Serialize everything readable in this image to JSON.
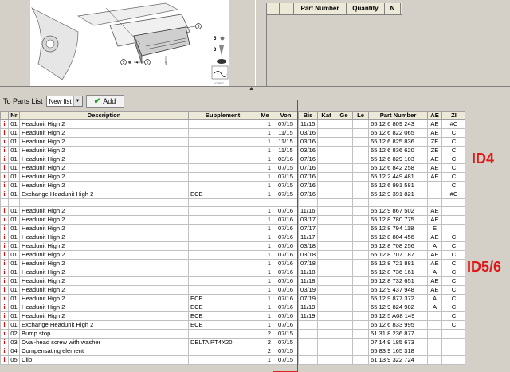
{
  "diagram": {
    "callouts": [
      "1",
      "2",
      "3",
      "4",
      "5"
    ],
    "legend_numbers": [
      "5",
      "3"
    ],
    "ref_code": "473902"
  },
  "parts_panel": {
    "headers": [
      "Part Number",
      "Quantity",
      "N"
    ]
  },
  "toolbar": {
    "to_parts_list_label": "To Parts List",
    "list_value": "New list",
    "add_label": "Add"
  },
  "table": {
    "headers": [
      "",
      "Nr",
      "Description",
      "Supplement",
      "Me",
      "Von",
      "Bis",
      "Kat",
      "Ge",
      "Le",
      "Part Number",
      "AE",
      "ZI"
    ],
    "rows": [
      {
        "nr": "01",
        "desc": "Headunit High 2",
        "sup": "",
        "me": "1",
        "von": "07/15",
        "bis": "11/15",
        "part": "65 12 6 809 243",
        "ae": "AE",
        "zi": "#C"
      },
      {
        "nr": "01",
        "desc": "Headunit High 2",
        "sup": "",
        "me": "1",
        "von": "11/15",
        "bis": "03/16",
        "part": "65 12 6 822 065",
        "ae": "AE",
        "zi": "C"
      },
      {
        "nr": "01",
        "desc": "Headunit High 2",
        "sup": "",
        "me": "1",
        "von": "11/15",
        "bis": "03/16",
        "part": "65 12 6 825 836",
        "ae": "ZE",
        "zi": "C"
      },
      {
        "nr": "01",
        "desc": "Headunit High 2",
        "sup": "",
        "me": "1",
        "von": "11/15",
        "bis": "03/16",
        "part": "65 12 6 836 620",
        "ae": "ZE",
        "zi": "C"
      },
      {
        "nr": "01",
        "desc": "Headunit High 2",
        "sup": "",
        "me": "1",
        "von": "03/16",
        "bis": "07/16",
        "part": "65 12 6 829 103",
        "ae": "AE",
        "zi": "C"
      },
      {
        "nr": "01",
        "desc": "Headunit High 2",
        "sup": "",
        "me": "1",
        "von": "07/15",
        "bis": "07/16",
        "part": "65 12 6 842 258",
        "ae": "AE",
        "zi": "C"
      },
      {
        "nr": "01",
        "desc": "Headunit High 2",
        "sup": "",
        "me": "1",
        "von": "07/15",
        "bis": "07/16",
        "part": "65 12 2 449 481",
        "ae": "AE",
        "zi": "C"
      },
      {
        "nr": "01",
        "desc": "Headunit High 2",
        "sup": "",
        "me": "1",
        "von": "07/15",
        "bis": "07/16",
        "part": "65 12 6 991 581",
        "ae": "",
        "zi": "C"
      },
      {
        "nr": "01",
        "desc": "Exchange Headunit High 2",
        "sup": "ECE",
        "me": "1",
        "von": "07/15",
        "bis": "07/16",
        "part": "65 12 9 391 821",
        "ae": "",
        "zi": "#C"
      },
      {
        "blank": true
      },
      {
        "nr": "01",
        "desc": "Headunit High 2",
        "sup": "",
        "me": "1",
        "von": "07/16",
        "bis": "11/16",
        "part": "65 12 9 867 502",
        "ae": "AE",
        "zi": ""
      },
      {
        "nr": "01",
        "desc": "Headunit High 2",
        "sup": "",
        "me": "1",
        "von": "07/16",
        "bis": "03/17",
        "part": "65 12 8 780 775",
        "ae": "AE",
        "zi": ""
      },
      {
        "nr": "01",
        "desc": "Headunit High 2",
        "sup": "",
        "me": "1",
        "von": "07/16",
        "bis": "07/17",
        "part": "65 12 8 794 118",
        "ae": "E",
        "zi": ""
      },
      {
        "nr": "01",
        "desc": "Headunit High 2",
        "sup": "",
        "me": "1",
        "von": "07/16",
        "bis": "11/17",
        "part": "65 12 8 804 456",
        "ae": "AE",
        "zi": "C"
      },
      {
        "nr": "01",
        "desc": "Headunit High 2",
        "sup": "",
        "me": "1",
        "von": "07/16",
        "bis": "03/18",
        "part": "65 12 8 708 256",
        "ae": "A",
        "zi": "C"
      },
      {
        "nr": "01",
        "desc": "Headunit High 2",
        "sup": "",
        "me": "1",
        "von": "07/16",
        "bis": "03/18",
        "part": "65 12 8 707 187",
        "ae": "AE",
        "zi": "C"
      },
      {
        "nr": "01",
        "desc": "Headunit High 2",
        "sup": "",
        "me": "1",
        "von": "07/16",
        "bis": "07/18",
        "part": "65 12 8 721 881",
        "ae": "AE",
        "zi": "C"
      },
      {
        "nr": "01",
        "desc": "Headunit High 2",
        "sup": "",
        "me": "1",
        "von": "07/16",
        "bis": "11/18",
        "part": "65 12 8 736 161",
        "ae": "A",
        "zi": "C"
      },
      {
        "nr": "01",
        "desc": "Headunit High 2",
        "sup": "",
        "me": "1",
        "von": "07/16",
        "bis": "11/18",
        "part": "65 12 8 732 651",
        "ae": "AE",
        "zi": "C"
      },
      {
        "nr": "01",
        "desc": "Headunit High 2",
        "sup": "",
        "me": "1",
        "von": "07/16",
        "bis": "03/19",
        "part": "65 12 9 437 948",
        "ae": "AE",
        "zi": "C"
      },
      {
        "nr": "01",
        "desc": "Headunit High 2",
        "sup": "ECE",
        "me": "1",
        "von": "07/16",
        "bis": "07/19",
        "part": "65 12 9 877 372",
        "ae": "A",
        "zi": "C"
      },
      {
        "nr": "01",
        "desc": "Headunit High 2",
        "sup": "ECE",
        "me": "1",
        "von": "07/16",
        "bis": "11/19",
        "part": "65 12 9 824 982",
        "ae": "A",
        "zi": "C"
      },
      {
        "nr": "01",
        "desc": "Headunit High 2",
        "sup": "ECE",
        "me": "1",
        "von": "07/16",
        "bis": "11/19",
        "part": "65 12 5 A08 149",
        "ae": "",
        "zi": "C"
      },
      {
        "nr": "01",
        "desc": "Exchange Headunit High 2",
        "sup": "ECE",
        "me": "1",
        "von": "07/16",
        "bis": "",
        "part": "65 12 6 833 995",
        "ae": "",
        "zi": "C"
      },
      {
        "nr": "02",
        "desc": "Bump stop",
        "sup": "",
        "me": "2",
        "von": "07/15",
        "bis": "",
        "part": "51 31 8 236 877",
        "ae": "",
        "zi": ""
      },
      {
        "nr": "03",
        "desc": "Oval-head screw with washer",
        "sup": "DELTA PT4X20",
        "me": "2",
        "von": "07/15",
        "bis": "",
        "part": "07 14 9 185 673",
        "ae": "",
        "zi": ""
      },
      {
        "nr": "04",
        "desc": "Compensating element",
        "sup": "",
        "me": "2",
        "von": "07/15",
        "bis": "",
        "part": "65 83 9 165 318",
        "ae": "",
        "zi": ""
      },
      {
        "nr": "05",
        "desc": "Clip",
        "sup": "",
        "me": "1",
        "von": "07/15",
        "bis": "",
        "part": "61 13 9 322 724",
        "ae": "",
        "zi": ""
      }
    ]
  },
  "annotations": {
    "id4": "ID4",
    "id56": "ID5/6"
  },
  "colors": {
    "annotation": "#e01818",
    "info_icon": "#cc1111"
  }
}
